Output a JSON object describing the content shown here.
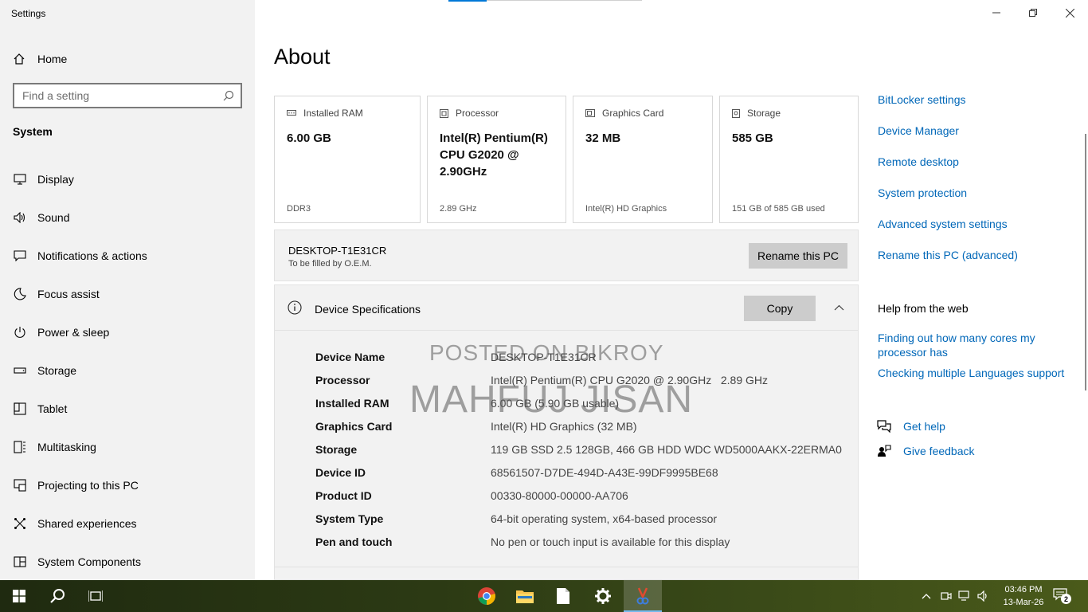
{
  "app": {
    "title": "Settings"
  },
  "sidebar": {
    "home_label": "Home",
    "search_placeholder": "Find a setting",
    "section": "System",
    "items": [
      {
        "label": "Display",
        "icon": "monitor-icon"
      },
      {
        "label": "Sound",
        "icon": "speaker-icon"
      },
      {
        "label": "Notifications & actions",
        "icon": "notification-icon"
      },
      {
        "label": "Focus assist",
        "icon": "moon-icon"
      },
      {
        "label": "Power & sleep",
        "icon": "power-icon"
      },
      {
        "label": "Storage",
        "icon": "storage-icon"
      },
      {
        "label": "Tablet",
        "icon": "tablet-icon"
      },
      {
        "label": "Multitasking",
        "icon": "multitasking-icon"
      },
      {
        "label": "Projecting to this PC",
        "icon": "project-icon"
      },
      {
        "label": "Shared experiences",
        "icon": "shared-icon"
      },
      {
        "label": "System Components",
        "icon": "components-icon"
      }
    ]
  },
  "main": {
    "title": "About",
    "cards": [
      {
        "label": "Installed RAM",
        "value": "6.00 GB",
        "sub": "DDR3",
        "icon": "ram-icon"
      },
      {
        "label": "Processor",
        "value": "Intel(R) Pentium(R) CPU G2020 @ 2.90GHz",
        "sub": "2.89 GHz",
        "icon": "processor-icon"
      },
      {
        "label": "Graphics Card",
        "value": "32 MB",
        "sub": "Intel(R) HD Graphics",
        "icon": "graphics-icon"
      },
      {
        "label": "Storage",
        "value": "585 GB",
        "sub": "151 GB of 585 GB used",
        "icon": "storage-icon"
      }
    ],
    "pc": {
      "name": "DESKTOP-T1E31CR",
      "oem": "To be filled by O.E.M.",
      "rename_label": "Rename this PC"
    },
    "specs": {
      "title": "Device Specifications",
      "copy_label": "Copy",
      "rows": [
        {
          "key": "Device Name",
          "value": "DESKTOP-T1E31CR"
        },
        {
          "key": "Processor",
          "value": "Intel(R) Pentium(R) CPU G2020 @ 2.90GHz   2.89 GHz"
        },
        {
          "key": "Installed RAM",
          "value": "6.00 GB (5.90 GB usable)"
        },
        {
          "key": "Graphics Card",
          "value": "Intel(R) HD Graphics (32 MB)"
        },
        {
          "key": "Storage",
          "value": "119 GB SSD 2.5 128GB, 466 GB HDD WDC WD5000AAKX-22ERMA0"
        },
        {
          "key": "Device ID",
          "value": "68561507-D7DE-494D-A43E-99DF9995BE68"
        },
        {
          "key": "Product ID",
          "value": "00330-80000-00000-AA706"
        },
        {
          "key": "System Type",
          "value": "64-bit operating system, x64-based processor"
        },
        {
          "key": "Pen and touch",
          "value": "No pen or touch input is available for this display"
        }
      ]
    },
    "watermark": {
      "line1": "POSTED ON BIKROY",
      "line2": "MAHFUJ JISAN"
    }
  },
  "related": {
    "links": [
      "BitLocker settings",
      "Device Manager",
      "Remote desktop",
      "System protection",
      "Advanced system settings",
      "Rename this PC (advanced)"
    ],
    "help_heading": "Help from the web",
    "help_links": [
      "Finding out how many cores my processor has",
      "Checking multiple Languages support"
    ],
    "get_help": "Get help",
    "give_feedback": "Give feedback"
  },
  "taskbar": {
    "time": "03:46 PM",
    "date": "13-Mar-26",
    "notification_count": "2"
  },
  "colors": {
    "accent": "#0078d7",
    "link": "#0067b8"
  }
}
